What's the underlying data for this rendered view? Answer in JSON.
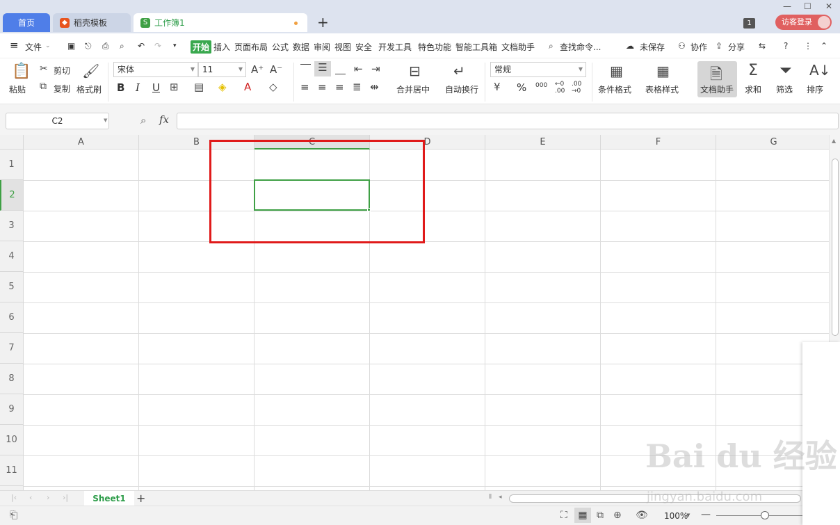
{
  "tabs": {
    "home": "首页",
    "templates": "稻壳模板",
    "workbook": "工作簿1",
    "new_tab_icon": "plus-icon"
  },
  "window": {
    "minimize": "—",
    "maximize": "☐",
    "close": "✕",
    "badge": "1",
    "login": "访客登录"
  },
  "menu": {
    "hamburger": "≡",
    "file": "文件",
    "items": [
      "开始",
      "插入",
      "页面布局",
      "公式",
      "数据",
      "审阅",
      "视图",
      "安全",
      "开发工具",
      "特色功能",
      "智能工具箱",
      "文档助手"
    ],
    "search": "查找命令...",
    "unsaved": "未保存",
    "collab": "协作",
    "share": "分享"
  },
  "ribbon": {
    "paste": "粘贴",
    "cut": "剪切",
    "copy": "复制",
    "format_painter": "格式刷",
    "font_name": "宋体",
    "font_size": "11",
    "bold": "B",
    "italic": "I",
    "underline": "U",
    "merge_center": "合并居中",
    "wrap_text": "自动换行",
    "number_format": "常规",
    "percent": "%",
    "thousands": "000",
    "inc_decimal": "←0 .00",
    "dec_decimal": ".00 →0",
    "conditional_format": "条件格式",
    "table_style": "表格样式",
    "doc_assistant": "文档助手",
    "sum": "求和",
    "filter": "筛选",
    "sort": "排序"
  },
  "formula_bar": {
    "name_box": "C2",
    "fx": "fx",
    "formula": ""
  },
  "grid": {
    "columns": [
      "A",
      "B",
      "C",
      "D",
      "E",
      "F",
      "G"
    ],
    "rows": [
      "1",
      "2",
      "3",
      "4",
      "5",
      "6",
      "7",
      "8",
      "9",
      "10",
      "11"
    ],
    "active_cell": "C2",
    "accent": "#3fa045",
    "highlight": "#e01a1a"
  },
  "sheets": {
    "tabs": [
      "Sheet1"
    ],
    "add": "+"
  },
  "status": {
    "zoom": "100%",
    "zoom_minus": "—",
    "zoom_plus": "+"
  },
  "watermark": {
    "brand": "Bai du 经验",
    "url": "jingyan.baidu.com"
  }
}
